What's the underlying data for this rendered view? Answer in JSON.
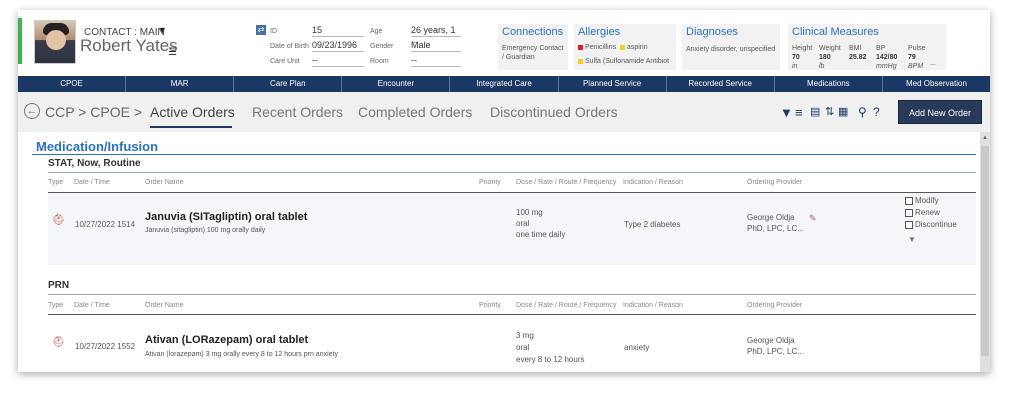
{
  "patient": {
    "contact_label": "CONTACT : MAIN",
    "name": "Robert Yates",
    "id_label": "ID",
    "id": "15",
    "age_label": "Age",
    "age": "26 years, 1 ...",
    "dob_label": "Date of Birth",
    "dob": "09/23/1996",
    "gender_label": "Gender",
    "gender": "Male",
    "care_unit_label": "Care Unit",
    "care_unit": "--",
    "room_label": "Room",
    "room": "--"
  },
  "widgets": {
    "connections": {
      "title": "Connections",
      "text1": "Emergency Contact",
      "text2": "/ Guardian"
    },
    "allergies": {
      "title": "Allergies",
      "items": [
        "Penicillins",
        "aspirin",
        "Sulfa (Sulfonamide Antibiot"
      ],
      "colors": [
        "#e02020",
        "#f2d21c",
        "#f2d21c"
      ]
    },
    "diagnoses": {
      "title": "Diagnoses",
      "text": "Anxiety disorder, unspecified"
    },
    "clinical": {
      "title": "Clinical Measures",
      "labels": [
        "Height",
        "Weight",
        "BMI",
        "BP",
        "Pulse"
      ],
      "values": [
        "70",
        "180",
        "25.82",
        "142/80",
        "79"
      ],
      "units": [
        "in",
        "lb",
        "",
        "mmHg",
        "BPM"
      ],
      "more": "..."
    }
  },
  "nav": [
    "CPOE",
    "MAR",
    "Care Plan",
    "Encounter",
    "Integrated Care",
    "Planned Service",
    "Recorded Service",
    "Medications",
    "Med Observation"
  ],
  "breadcrumb": "CCP > CPOE >",
  "tabs": [
    "Active Orders",
    "Recent Orders",
    "Completed Orders",
    "Discontinued Orders"
  ],
  "add_button": "Add New Order",
  "section_title": "Medication/Infusion",
  "columns": [
    "Type",
    "Date / Time",
    "Order Name",
    "Priority",
    "Dose / Rate / Route / Frequency",
    "Indication / Reason",
    "Ordering Provider"
  ],
  "groups": [
    {
      "title": "STAT, Now, Routine",
      "order": {
        "datetime": "10/27/2022 1514",
        "name": "Januvia (SITagliptin) oral tablet",
        "detail": "Januvia (sitagliptin) 100 mg orally daily",
        "dose": "100 mg",
        "route": "oral",
        "freq": "one time daily",
        "indication": "Type 2 diabetes",
        "provider1": "George Oldja",
        "provider2": "PhD, LPC, LC..."
      },
      "actions": [
        "Modify",
        "Renew",
        "Discontinue"
      ]
    },
    {
      "title": "PRN",
      "order": {
        "datetime": "10/27/2022 1552",
        "name": "Ativan (LORazepam) oral tablet",
        "detail": "Ativan (lorazepam) 3 mg orally every 8 to 12 hours prn anxiety",
        "dose": "3 mg",
        "route": "oral",
        "freq": "every 8 to 12 hours",
        "indication": "anxiety",
        "provider1": "George Oldja",
        "provider2": "PhD, LPC, LC..."
      }
    }
  ]
}
